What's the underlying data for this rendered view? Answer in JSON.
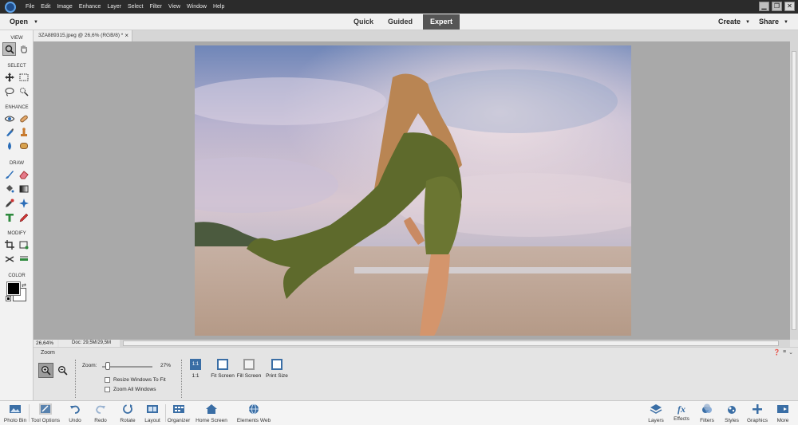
{
  "menubar": {
    "items": [
      "File",
      "Edit",
      "Image",
      "Enhance",
      "Layer",
      "Select",
      "Filter",
      "View",
      "Window",
      "Help"
    ],
    "window_controls": {
      "minimize": "▁",
      "restore": "❐",
      "close": "✕"
    }
  },
  "modebar": {
    "open_label": "Open",
    "modes": [
      "Quick",
      "Guided",
      "Expert"
    ],
    "active_mode": "Expert",
    "create_label": "Create",
    "share_label": "Share"
  },
  "document": {
    "tab_title": "3ZA889315.jpeg @ 26,6% (RGB/8) *",
    "close_glyph": "×"
  },
  "toolbox": {
    "sections": [
      "VIEW",
      "SELECT",
      "ENHANCE",
      "DRAW",
      "MODIFY",
      "COLOR"
    ],
    "foreground_color": "#000000",
    "background_color": "#ffffff"
  },
  "status": {
    "zoom": "26,64%",
    "doc_size": "Doc: 29,5M/29,5M"
  },
  "tool_options": {
    "title": "Zoom",
    "zoom_label": "Zoom:",
    "zoom_value": "27%",
    "zoom_level": 0.27,
    "resize_windows": "Resize Windows To Fit",
    "zoom_all": "Zoom All Windows",
    "one_to_one_icon": "1:1",
    "one_to_one_label": "1:1",
    "fit_screen": "Fit Screen",
    "fill_screen": "Fill Screen",
    "print_size": "Print Size"
  },
  "taskbar": {
    "left": [
      "Photo Bin",
      "Tool Options",
      "Undo",
      "Redo",
      "Rotate",
      "Layout",
      "Organizer",
      "Home Screen",
      "Elements Web"
    ],
    "right": [
      "Layers",
      "Effects",
      "Filters",
      "Styles",
      "Graphics",
      "More"
    ]
  },
  "colors": {
    "accent": "#3a6ea5",
    "menubar": "#2b2b2b",
    "canvas_bg": "#a9a9a9"
  }
}
